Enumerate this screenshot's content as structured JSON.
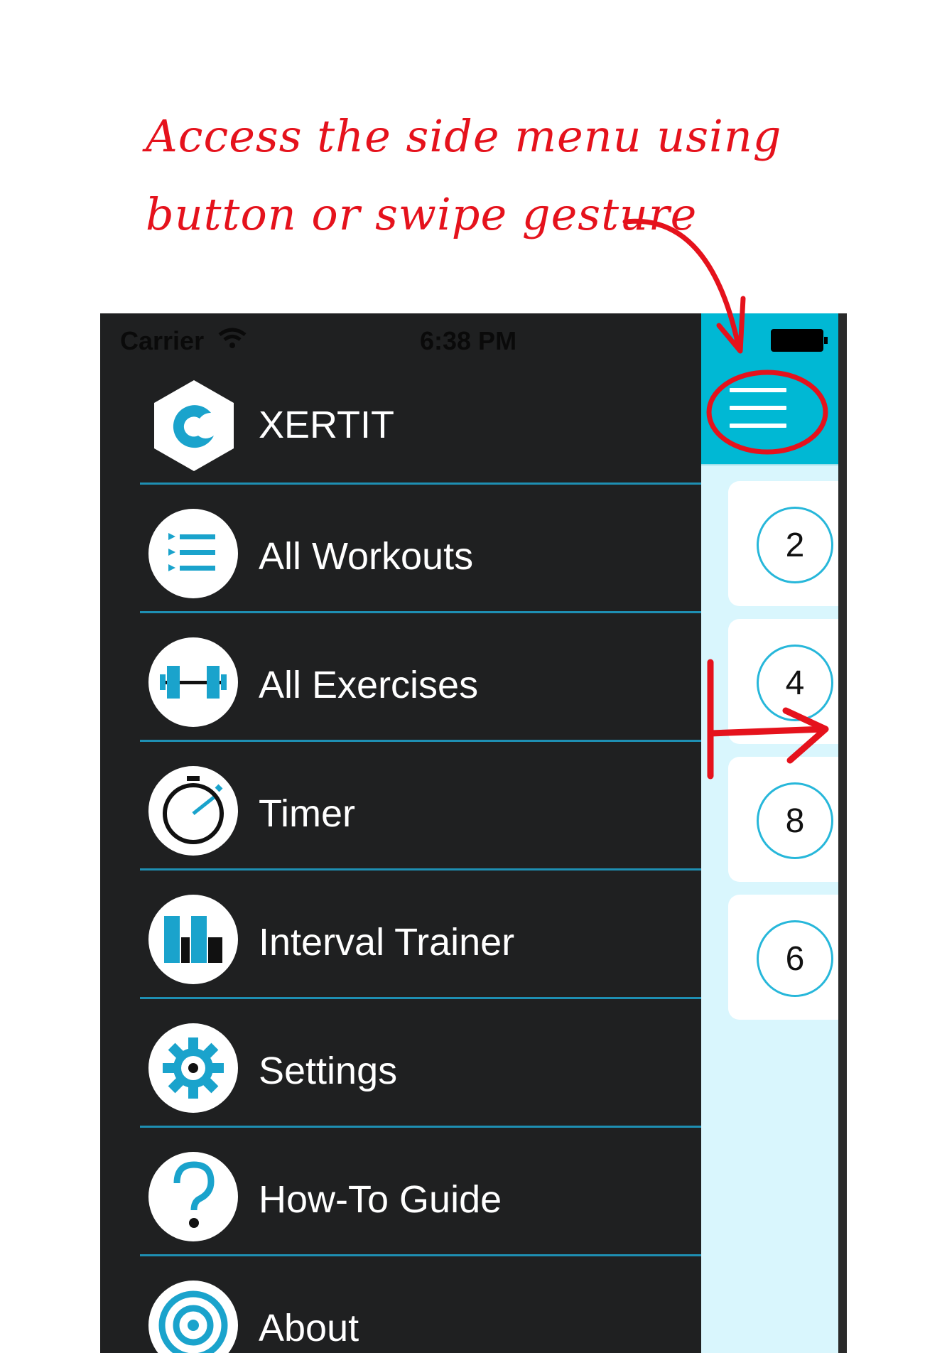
{
  "annotation": {
    "line1": "Access the side menu using",
    "line2": "button or swipe gesture",
    "color": "#e5121c"
  },
  "status_bar": {
    "carrier": "Carrier",
    "time": "6:38 PM"
  },
  "menu": {
    "brand": {
      "label": "XERTIT",
      "icon": "xertit-logo-icon"
    },
    "items": [
      {
        "label": "All Workouts",
        "icon": "list-icon"
      },
      {
        "label": "All Exercises",
        "icon": "dumbbell-icon"
      },
      {
        "label": "Timer",
        "icon": "stopwatch-icon"
      },
      {
        "label": "Interval Trainer",
        "icon": "bar-chart-icon"
      },
      {
        "label": "Settings",
        "icon": "gear-icon"
      },
      {
        "label": "How-To Guide",
        "icon": "question-mark-icon"
      },
      {
        "label": "About",
        "icon": "target-icon"
      }
    ],
    "divider_color": "#1e8fb3",
    "background": "#1f2021"
  },
  "content": {
    "nav_color": "#00b8d4",
    "background": "#d9f6fd",
    "cards": [
      {
        "value": "2"
      },
      {
        "value": "4"
      },
      {
        "value": "8"
      },
      {
        "value": "6"
      }
    ]
  }
}
